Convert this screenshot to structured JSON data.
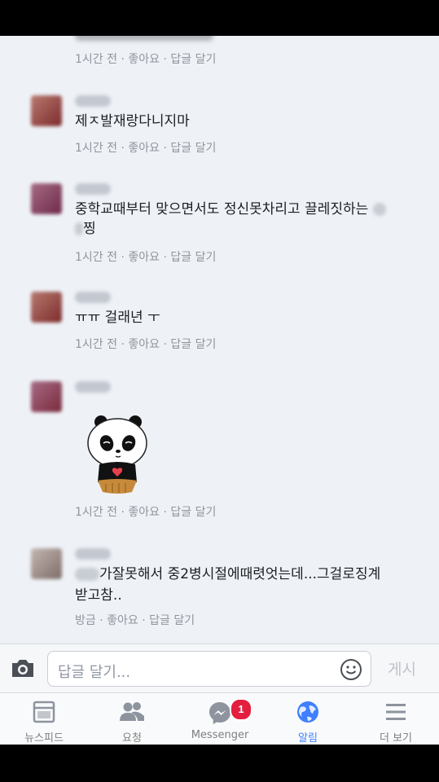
{
  "comments": [
    {
      "text": "",
      "meta": {
        "time": "1시간 전",
        "like": "좋아요",
        "reply": "답글 달기"
      }
    },
    {
      "text": "제ㅈ발재랑다니지마",
      "meta": {
        "time": "1시간 전",
        "like": "좋아요",
        "reply": "답글 달기"
      }
    },
    {
      "text_line1": "중학교때부터 맞으면서도 정신못차리고 끌레짓하는",
      "text_line2": "찡",
      "meta": {
        "time": "1시간 전",
        "like": "좋아요",
        "reply": "답글 달기"
      }
    },
    {
      "text": "ㅠㅠ 걸래년 ㅜ",
      "meta": {
        "time": "1시간 전",
        "like": "좋아요",
        "reply": "답글 달기"
      }
    },
    {
      "sticker": "panda-heart-sticker",
      "meta": {
        "time": "1시간 전",
        "like": "좋아요",
        "reply": "답글 달기"
      }
    },
    {
      "text_line1": "가잘못해서 중2병시절에때렷엇는데...그걸로징계",
      "text_line2": "받고참..",
      "meta": {
        "time": "방금",
        "like": "좋아요",
        "reply": "답글 달기"
      }
    }
  ],
  "composer": {
    "placeholder": "답글 달기...",
    "post_label": "게시",
    "camera_icon": "camera-icon",
    "emoji_icon": "smiley-icon"
  },
  "tabs": [
    {
      "label": "뉴스피드",
      "icon": "news-feed-icon"
    },
    {
      "label": "요청",
      "icon": "friend-requests-icon"
    },
    {
      "label": "Messenger",
      "icon": "messenger-icon",
      "badge": "1"
    },
    {
      "label": "알림",
      "icon": "globe-icon",
      "active": true
    },
    {
      "label": "더 보기",
      "icon": "menu-icon"
    }
  ],
  "colors": {
    "active_tab": "#4080ff",
    "badge": "#e41e3f"
  }
}
